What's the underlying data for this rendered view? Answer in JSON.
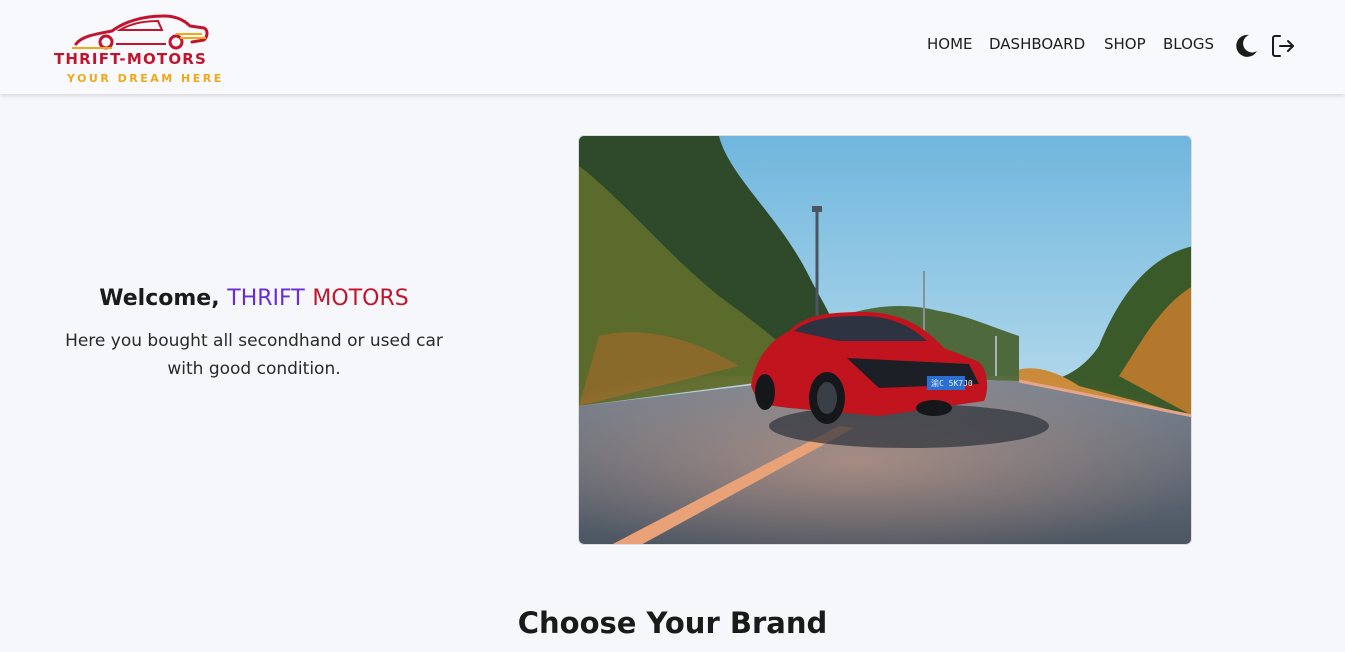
{
  "brand": {
    "title": "THRIFT-MOTORS",
    "tagline": "YOUR DREAM HERE",
    "primary_color": "#c3142d",
    "accent_color": "#f0a81a"
  },
  "nav": {
    "home": "HOME",
    "dashboard": "DASHBOARD",
    "shop": "SHOP",
    "blogs": "BLOGS",
    "theme_icon": "moon-icon",
    "logout_icon": "logout-icon"
  },
  "hero": {
    "welcome_prefix": "Welcome, ",
    "brand_part1": "THRIFT",
    "brand_part2": "MOTORS",
    "brand_part1_color": "#6a2bd8",
    "brand_part2_color": "#c3142d",
    "subtitle": "Here you bought all secondhand or used car with good condition.",
    "license_plate": "渝C 5K7J0"
  },
  "section": {
    "title": "Choose Your Brand"
  }
}
